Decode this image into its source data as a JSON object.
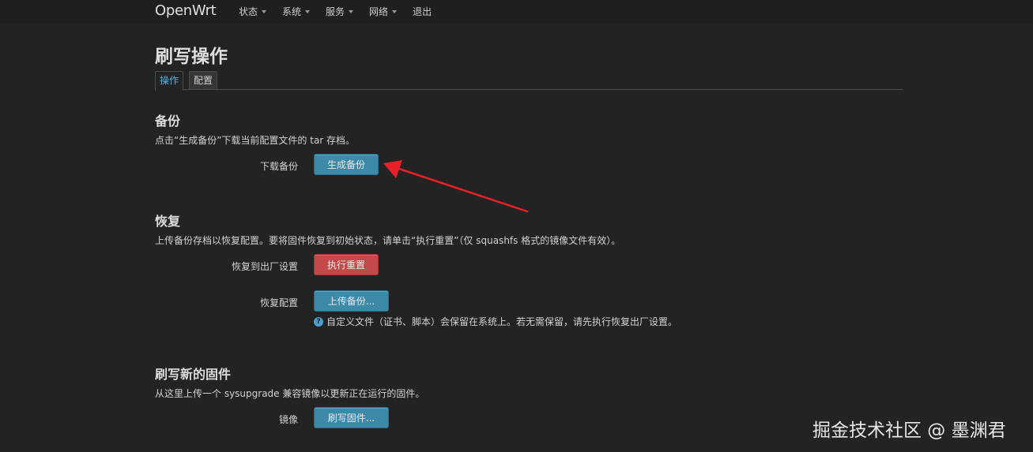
{
  "navbar": {
    "brand": "OpenWrt",
    "items": [
      {
        "label": "状态"
      },
      {
        "label": "系统"
      },
      {
        "label": "服务"
      },
      {
        "label": "网络"
      },
      {
        "label": "退出"
      }
    ]
  },
  "page": {
    "title": "刷写操作",
    "tabs": [
      {
        "label": "操作",
        "active": true
      },
      {
        "label": "配置",
        "active": false
      }
    ]
  },
  "backup": {
    "title": "备份",
    "description": "点击“生成备份”下载当前配置文件的 tar 存档。",
    "download_label": "下载备份",
    "generate_button": "生成备份"
  },
  "restore": {
    "title": "恢复",
    "description": "上传备份存档以恢复配置。要将固件恢复到初始状态，请单击“执行重置”（仅 squashfs 格式的镜像文件有效）。",
    "factory_label": "恢复到出厂设置",
    "reset_button": "执行重置",
    "restore_label": "恢复配置",
    "upload_button": "上传备份...",
    "hint": "自定义文件（证书、脚本）会保留在系统上。若无需保留，请先执行恢复出厂设置。"
  },
  "flash": {
    "title": "刷写新的固件",
    "description": "从这里上传一个 sysupgrade 兼容镜像以更新正在运行的固件。",
    "image_label": "镜像",
    "flash_button": "刷写固件..."
  },
  "watermark": "掘金技术社区 @ 墨渊君",
  "colors": {
    "background": "#232323",
    "accent_blue": "#3d8aa8",
    "danger_red": "#c44a4a",
    "annotation_arrow": "#e8202a"
  }
}
